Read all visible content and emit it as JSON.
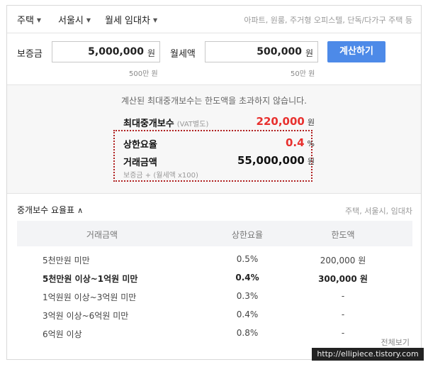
{
  "topbar": {
    "dropdowns": [
      "주택",
      "서울시",
      "월세 임대차"
    ],
    "categories": "아파트, 원룸, 주거형 오피스텔, 단독/다가구 주택 등"
  },
  "inputs": {
    "deposit_label": "보증금",
    "deposit_value": "5,000,000",
    "deposit_unit": "원",
    "deposit_hint": "500만 원",
    "rent_label": "월세액",
    "rent_value": "500,000",
    "rent_unit": "원",
    "rent_hint": "50만 원",
    "calc_button": "계산하기"
  },
  "result": {
    "message": "계산된 최대중개보수는 한도액을 초과하지 않습니다.",
    "max_fee_label": "최대중개보수",
    "max_fee_note": "(VAT별도)",
    "max_fee_value": "220,000",
    "max_fee_unit": "원",
    "rate_label": "상한요율",
    "rate_value": "0.4",
    "rate_unit": "%",
    "amount_label": "거래금액",
    "amount_value": "55,000,000",
    "amount_unit": "원",
    "amount_formula": "보증금 + (월세액 x100)"
  },
  "table": {
    "title": "중개보수 요율표",
    "tag": "주택, 서울시, 임대차",
    "headers": [
      "거래금액",
      "상한요율",
      "한도액"
    ],
    "rows": [
      {
        "range": "5천만원 미만",
        "rate": "0.5%",
        "limit": "200,000 원"
      },
      {
        "range": "5천만원 이상~1억원 미만",
        "rate": "0.4%",
        "limit": "300,000 원"
      },
      {
        "range": "1억원원 이상~3억원 미만",
        "rate": "0.3%",
        "limit": "-"
      },
      {
        "range": "3억원 이상~6억원 미만",
        "rate": "0.4%",
        "limit": "-"
      },
      {
        "range": "6억원 이상",
        "rate": "0.8%",
        "limit": "-"
      }
    ],
    "more": "전체보기"
  },
  "watermark": "http://ellipiece.tistory.com",
  "colors": {
    "accent": "#4d8ae8",
    "highlight": "#e8302e",
    "annotation": "#b02020"
  }
}
